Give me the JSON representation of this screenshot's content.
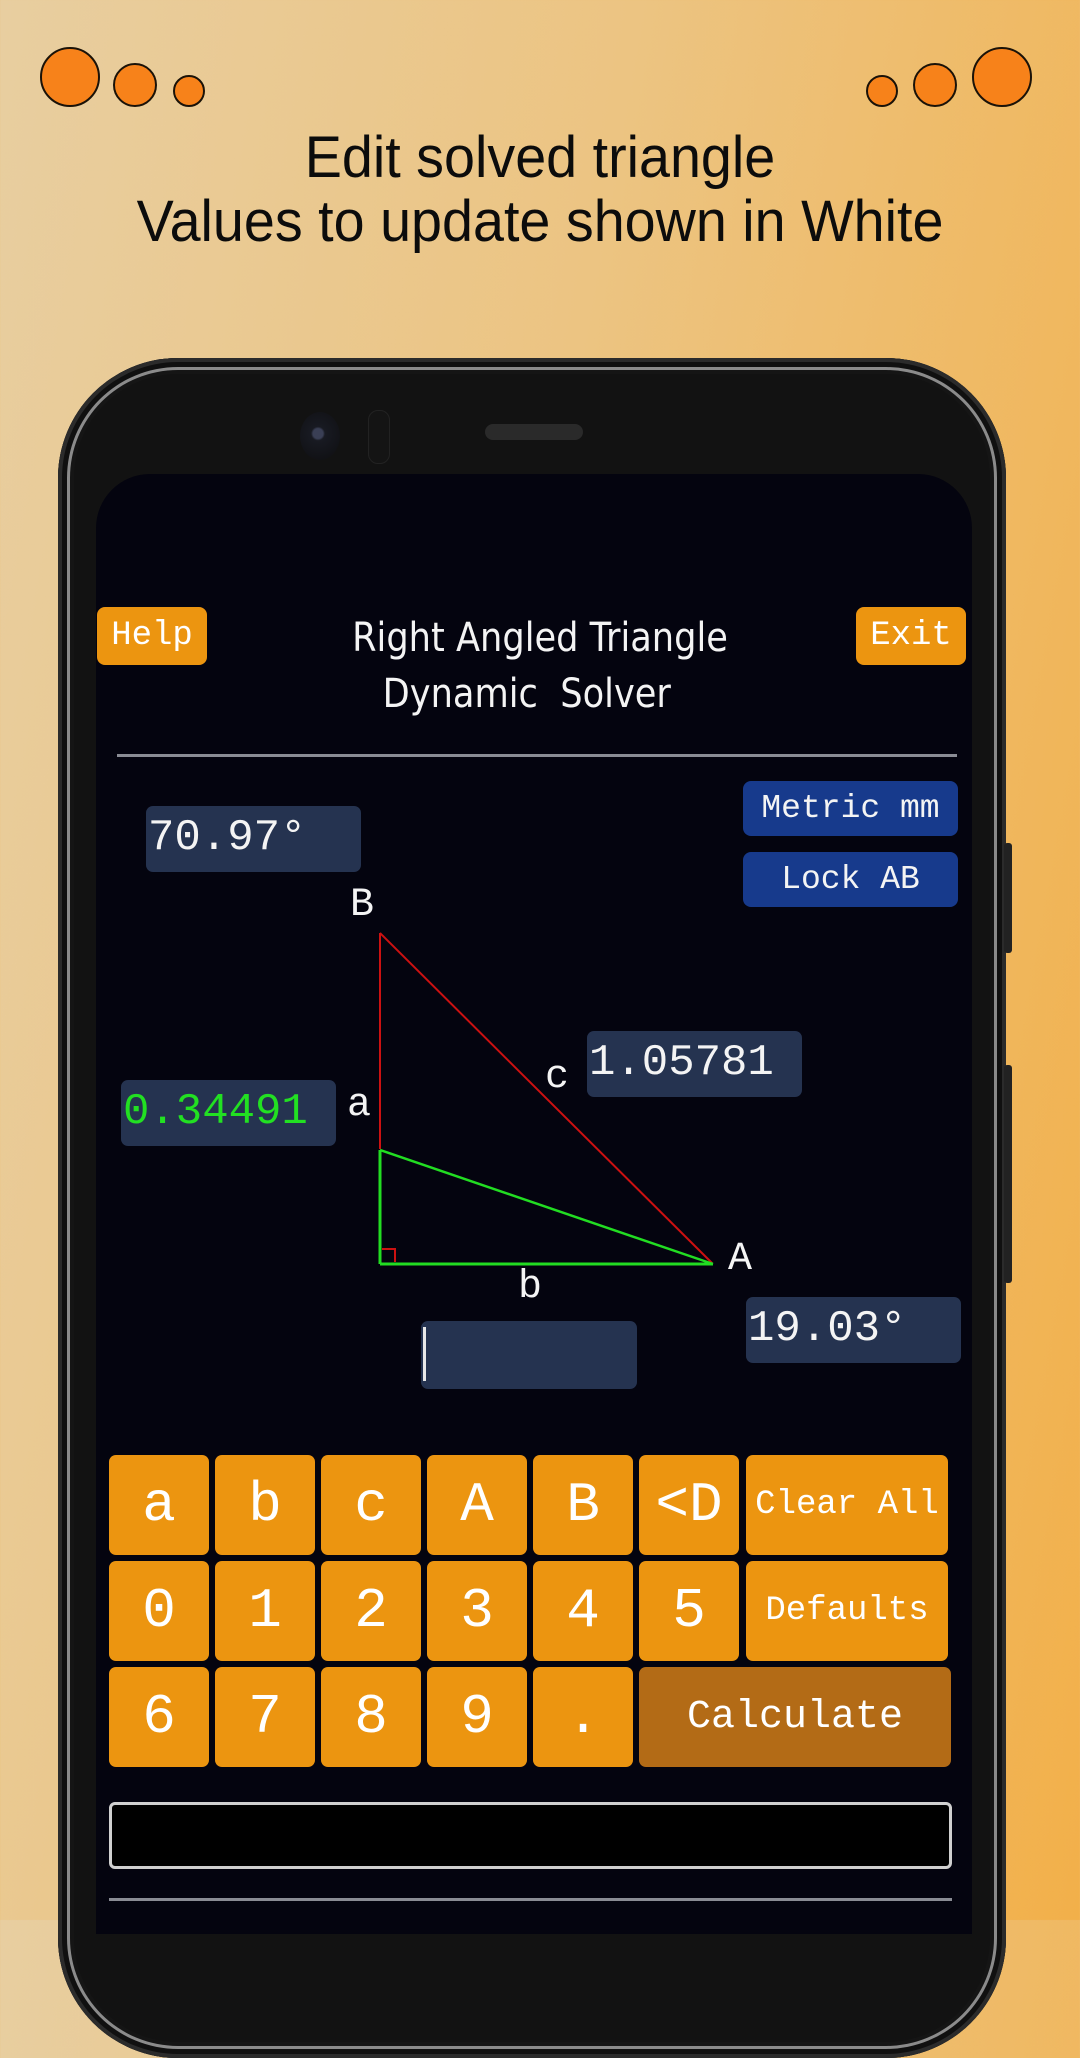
{
  "promo": {
    "line1": "Edit solved triangle",
    "line2": "Values to update shown in White",
    "dot_color": "#f7821a"
  },
  "app": {
    "help_label": "Help",
    "exit_label": "Exit",
    "title_line1": "Right Angled Triangle",
    "title_line2": "Dynamic  Solver",
    "units_label": "Metric mm",
    "lock_label": "Lock AB"
  },
  "triangle": {
    "angle_B": "70.97°",
    "angle_A": "19.03°",
    "side_a": "0.34491",
    "side_b": "",
    "side_c": "1.05781",
    "vertex_labels": {
      "B": "B",
      "A": "A"
    },
    "side_labels": {
      "a": "a",
      "b": "b",
      "c": "c"
    },
    "colors": {
      "original": "#cc1111",
      "updated": "#22dd22",
      "highlight_value": "#22e022",
      "value_box": "#253350"
    }
  },
  "keypad": {
    "rows": [
      [
        "a",
        "b",
        "c",
        "A",
        "B",
        "<D",
        "Clear All"
      ],
      [
        "0",
        "1",
        "2",
        "3",
        "4",
        "5",
        "Defaults"
      ],
      [
        "6",
        "7",
        "8",
        "9",
        ".",
        "Calculate"
      ]
    ],
    "key_color": "#ec9510",
    "calculate_color": "#b36b16"
  },
  "status": {
    "message": ""
  }
}
